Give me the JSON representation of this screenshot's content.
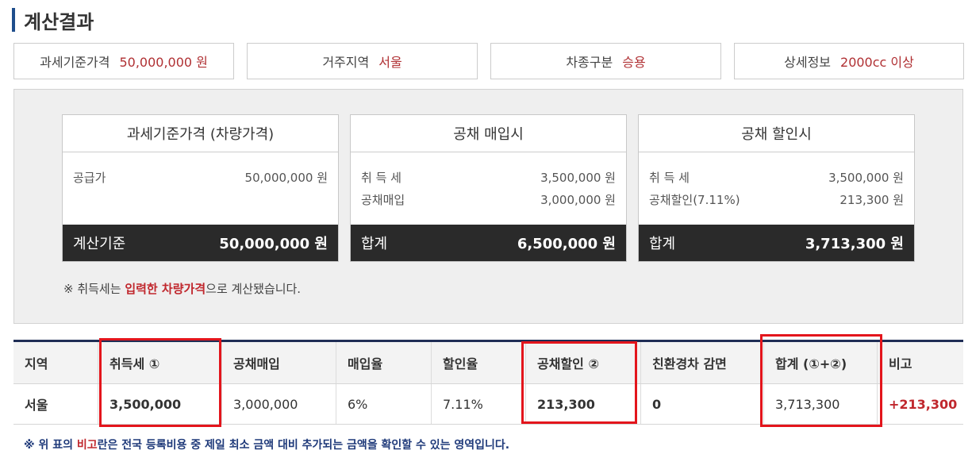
{
  "title": "계산결과",
  "info": [
    {
      "label": "과세기준가격",
      "value": "50,000,000 원"
    },
    {
      "label": "거주지역",
      "value": "서울"
    },
    {
      "label": "차종구분",
      "value": "승용"
    },
    {
      "label": "상세정보",
      "value": "2000cc 이상"
    }
  ],
  "cards": [
    {
      "head": "과세기준가격 (차량가격)",
      "rows": [
        {
          "label": "공급가",
          "value": "50,000,000 원"
        }
      ],
      "foot_label": "계산기준",
      "foot_value": "50,000,000 원"
    },
    {
      "head": "공채 매입시",
      "rows": [
        {
          "label": "취 득 세",
          "value": "3,500,000 원"
        },
        {
          "label": "공채매입",
          "value": "3,000,000 원"
        }
      ],
      "foot_label": "합계",
      "foot_value": "6,500,000 원"
    },
    {
      "head": "공채 할인시",
      "rows": [
        {
          "label": "취 득 세",
          "value": "3,500,000 원"
        },
        {
          "label": "공채할인(7.11%)",
          "value": "213,300 원"
        }
      ],
      "foot_label": "합계",
      "foot_value": "3,713,300 원"
    }
  ],
  "note": {
    "prefix": "※ 취득세는 ",
    "highlight": "입력한 차량가격",
    "suffix": "으로 계산됐습니다."
  },
  "table": {
    "headers": [
      "지역",
      "취득세 ①",
      "공채매입",
      "매입율",
      "할인율",
      "공채할인 ②",
      "친환경차 감면",
      "합계 (①+②)",
      "비고"
    ],
    "row": [
      "서울",
      "3,500,000",
      "3,000,000",
      "6%",
      "7.11%",
      "213,300",
      "0",
      "3,713,300",
      "+213,300"
    ]
  },
  "footnote": {
    "prefix": "※ 위 표의 ",
    "highlight": "비고",
    "suffix": "란은 전국 등록비용 중 제일 최소 금액 대비 추가되는 금액을 확인할 수 있는 영역입니다."
  }
}
